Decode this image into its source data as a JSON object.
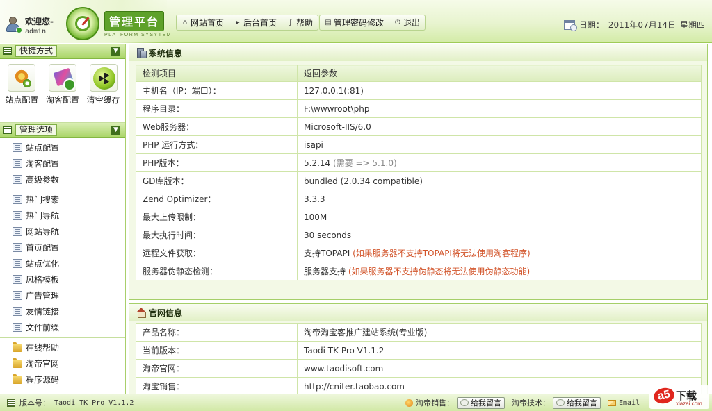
{
  "header": {
    "welcome": "欢迎您-",
    "username": "admin",
    "brand_title": "管理平台",
    "brand_subtitle": "PLATFORM SYSYTEM",
    "nav_primary": [
      {
        "icon": "home-icon",
        "label": "网站首页"
      },
      {
        "icon": "play-icon",
        "label": "后台首页"
      },
      {
        "icon": "help-icon",
        "label": "帮助"
      }
    ],
    "nav_secondary": [
      {
        "icon": "password-icon",
        "label": "管理密码修改"
      },
      {
        "icon": "power-icon",
        "label": "退出"
      }
    ],
    "date_label": "日期：",
    "date_value": "2011年07月14日",
    "weekday": "星期四"
  },
  "sidebar": {
    "quick_title": "快捷方式",
    "quick_items": [
      {
        "icon": "gear-icon",
        "label": "站点配置"
      },
      {
        "icon": "pen-icon",
        "label": "淘客配置"
      },
      {
        "icon": "radiation-icon",
        "label": "清空缓存"
      }
    ],
    "manage_title": "管理选项",
    "group1": [
      "站点配置",
      "淘客配置",
      "高级参数"
    ],
    "group2": [
      "热门搜索",
      "热门导航",
      "网站导航",
      "首页配置",
      "站点优化",
      "风格模板",
      "广告管理",
      "友情链接",
      "文件前缀"
    ],
    "group3": [
      "在线帮助",
      "淘帝官网",
      "程序源码"
    ]
  },
  "system_panel": {
    "title": "系统信息",
    "header": {
      "key": "检测项目",
      "value": "返回参数"
    },
    "rows": [
      {
        "key": "主机名（IP：端口）：",
        "value": "127.0.0.1(:81)"
      },
      {
        "key": "程序目录：",
        "value": "F:\\wwwroot\\php"
      },
      {
        "key": "Web服务器：",
        "value": "Microsoft-IIS/6.0"
      },
      {
        "key": "PHP 运行方式：",
        "value": "isapi"
      },
      {
        "key": "PHP版本：",
        "value": "5.2.14",
        "note": "(需要  => 5.1.0)"
      },
      {
        "key": "GD库版本：",
        "value": "bundled (2.0.34 compatible)"
      },
      {
        "key": "Zend Optimizer：",
        "value": "3.3.3"
      },
      {
        "key": "最大上传限制：",
        "value": "100M"
      },
      {
        "key": "最大执行时间：",
        "value": "30 seconds"
      },
      {
        "key": "远程文件获取：",
        "value": "支持TOPAPI",
        "warning": "(如果服务器不支持TOPAPI将无法使用淘客程序)"
      },
      {
        "key": "服务器伪静态检测：",
        "value": "服务器支持",
        "warning": "(如果服务器不支持伪静态将无法使用伪静态功能)"
      }
    ]
  },
  "official_panel": {
    "title": "官网信息",
    "rows": [
      {
        "key": "产品名称：",
        "value": "淘帝淘宝客推广建站系统(专业版)"
      },
      {
        "key": "当前版本：",
        "value": "Taodi TK Pro V1.1.2"
      },
      {
        "key": "淘帝官网：",
        "value": "www.taodisoft.com"
      },
      {
        "key": "淘宝销售：",
        "value": "http://cniter.taobao.com"
      }
    ]
  },
  "statusbar": {
    "version_label": "版本号：",
    "version_value": "Taodi TK Pro V1.1.2",
    "sales_label": "淘帝销售：",
    "sales_button": "给我留言",
    "tech_label": "淘帝技术：",
    "tech_button": "给我留言",
    "email_label": "Email"
  },
  "watermark": {
    "logo": "a5",
    "text": "下载",
    "site": "xiazai.com"
  },
  "colors": {
    "accent": "#6fb52a",
    "header_bg": "#e8f4cf",
    "warning": "#d2542a",
    "border": "#a5cf69"
  }
}
